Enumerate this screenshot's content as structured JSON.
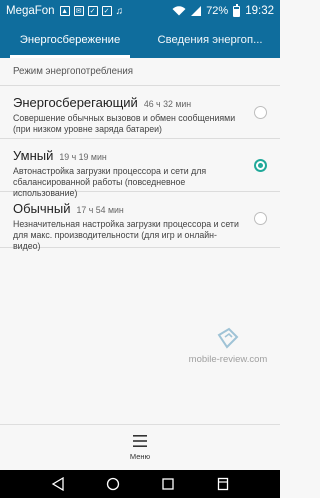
{
  "status_bar": {
    "carrier": "MegaFon",
    "battery": "72%",
    "time": "19:32",
    "icons": [
      "image-icon",
      "mail-icon",
      "checkbox-icon",
      "checkbox-icon",
      "music-icon",
      "wifi-icon",
      "signal-icon",
      "battery-icon"
    ]
  },
  "tabs": [
    {
      "label": "Энергосбережение",
      "active": true
    },
    {
      "label": "Сведения энергоп...",
      "active": false
    }
  ],
  "section": {
    "title": "Режим энергопотребления"
  },
  "options": [
    {
      "title": "Энергосберегающий",
      "time": "46 ч 32 мин",
      "description": "Совершение обычных вызовов и обмен сообщениями (при низком уровне заряда батареи)",
      "selected": false
    },
    {
      "title": "Умный",
      "time": "19 ч 19 мин",
      "description": "Автонастройка загрузки процессора и сети для сбалансированной работы (повседневное использование)",
      "selected": true
    },
    {
      "title": "Обычный",
      "time": "17 ч 54 мин",
      "description": "Незначительная настройка загрузки процессора и сети для макс. производительности (для игр и онлайн-видео)",
      "selected": false
    }
  ],
  "watermark": {
    "text": "mobile-review.com"
  },
  "bottom_bar": {
    "menu_label": "Меню"
  },
  "nav_bar": {
    "buttons": [
      "back-icon",
      "home-icon",
      "recents-icon",
      "notifications-icon"
    ]
  },
  "colors": {
    "header": "#0f6d9d",
    "accent": "#21a99a",
    "background": "#f7f7f7"
  }
}
